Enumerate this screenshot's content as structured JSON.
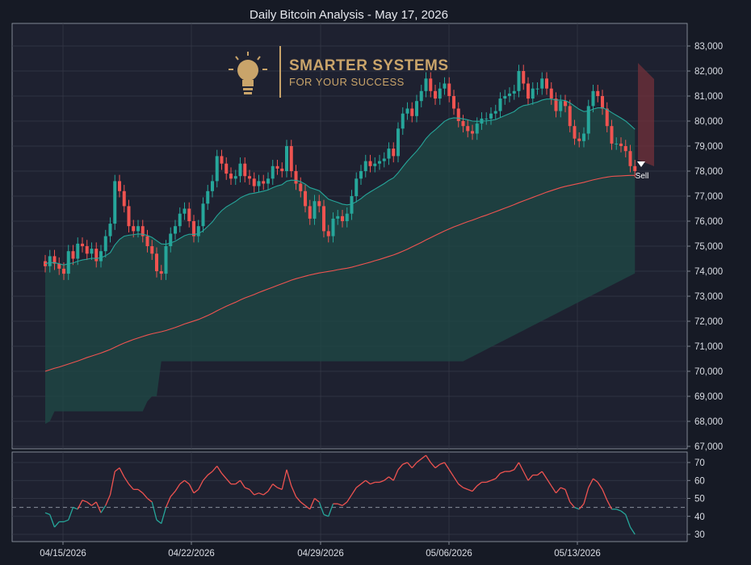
{
  "title": "Daily Bitcoin Analysis - May 17, 2026",
  "logo": {
    "line1": "SMARTER SYSTEMS",
    "line2": "FOR YOUR SUCCESS"
  },
  "colors": {
    "background": "#161a25",
    "panel": "#1e2130",
    "grid": "#363a48",
    "up": "#26a69a",
    "down": "#ef5350",
    "cloud": "#1f4a45",
    "ema_slow": "#ef5350",
    "ema_fast": "#26a69a",
    "logo": "#c9a46a"
  },
  "signal": {
    "label": "Sell"
  },
  "chart_data": [
    {
      "type": "candlestick",
      "title": "Daily Bitcoin Analysis - May 17, 2026",
      "x_tick_labels": [
        "04/15/2026",
        "04/22/2026",
        "04/29/2026",
        "05/06/2026",
        "05/13/2026"
      ],
      "y_ticks": [
        67000,
        68000,
        69000,
        70000,
        71000,
        72000,
        73000,
        74000,
        75000,
        76000,
        77000,
        78000,
        79000,
        80000,
        81000,
        82000,
        83000
      ],
      "ylim": [
        67000,
        83300
      ],
      "grid": true,
      "legend": "none",
      "close": [
        74200,
        74600,
        74300,
        74100,
        73900,
        74800,
        74500,
        75100,
        75000,
        74700,
        74900,
        74400,
        74800,
        75400,
        75900,
        77600,
        77200,
        76600,
        75800,
        75600,
        75800,
        75400,
        75000,
        74700,
        74000,
        73900,
        75000,
        75500,
        75800,
        76300,
        76500,
        76000,
        75400,
        75800,
        76700,
        77200,
        77600,
        78600,
        78300,
        77900,
        77700,
        77800,
        78300,
        77800,
        77700,
        77400,
        77600,
        77500,
        77700,
        78200,
        78100,
        78000,
        79000,
        78000,
        77500,
        77200,
        76600,
        76100,
        76800,
        76600,
        75600,
        75400,
        76100,
        76200,
        76000,
        76300,
        77000,
        77700,
        78000,
        78400,
        78200,
        78300,
        78400,
        78500,
        78900,
        78600,
        79700,
        80300,
        80500,
        80200,
        80800,
        81200,
        81700,
        81200,
        80900,
        81300,
        81500,
        81000,
        80500,
        80000,
        79800,
        79600,
        79500,
        79900,
        80100,
        80100,
        80300,
        80400,
        80900,
        81000,
        81100,
        81200,
        82000,
        81500,
        80900,
        81300,
        81300,
        81700,
        81300,
        80900,
        80400,
        80800,
        80600,
        79800,
        79300,
        79200,
        79500,
        80600,
        81200,
        81000,
        80500,
        79800,
        79100,
        79100,
        79000,
        78800,
        78200,
        78000
      ],
      "open": [
        74400,
        74200,
        74600,
        74300,
        74100,
        73900,
        74800,
        74500,
        75100,
        75000,
        74700,
        74900,
        74400,
        74800,
        75400,
        75900,
        77600,
        77200,
        76600,
        75800,
        75600,
        75800,
        75400,
        75000,
        74700,
        74000,
        73900,
        75000,
        75500,
        75800,
        76300,
        76500,
        76000,
        75400,
        75800,
        76700,
        77200,
        77600,
        78600,
        78300,
        77900,
        77700,
        77800,
        78300,
        77800,
        77700,
        77400,
        77600,
        77500,
        77700,
        78200,
        78100,
        78000,
        79000,
        78000,
        77500,
        77200,
        76600,
        76100,
        76800,
        76600,
        75600,
        75400,
        76100,
        76200,
        76000,
        76300,
        77000,
        77700,
        78000,
        78400,
        78200,
        78300,
        78400,
        78500,
        78900,
        78600,
        79700,
        80300,
        80500,
        80200,
        80800,
        81200,
        81700,
        81200,
        80900,
        81300,
        81500,
        81000,
        80500,
        80000,
        79800,
        79600,
        79500,
        79900,
        80100,
        80100,
        80300,
        80400,
        80900,
        81000,
        81100,
        81200,
        82000,
        81500,
        80900,
        81300,
        81300,
        81700,
        81300,
        80900,
        80400,
        80800,
        80600,
        79800,
        79300,
        79200,
        79500,
        80600,
        81200,
        81000,
        80500,
        79800,
        79100,
        79100,
        79000,
        78800,
        78200
      ],
      "ema_fast": [
        74300,
        74350,
        74340,
        74300,
        74250,
        74300,
        74330,
        74400,
        74450,
        74480,
        74520,
        74510,
        74540,
        74620,
        74740,
        75050,
        75270,
        75400,
        75440,
        75460,
        75490,
        75480,
        75430,
        75350,
        75220,
        75090,
        75080,
        75130,
        75200,
        75310,
        75420,
        75480,
        75470,
        75500,
        75620,
        75790,
        75970,
        76220,
        76420,
        76570,
        76680,
        76790,
        76930,
        77020,
        77090,
        77120,
        77160,
        77200,
        77250,
        77340,
        77410,
        77460,
        77600,
        77640,
        77630,
        77580,
        77480,
        77340,
        77280,
        77220,
        77050,
        76880,
        76810,
        76750,
        76680,
        76650,
        76680,
        76780,
        76900,
        77050,
        77170,
        77280,
        77390,
        77500,
        77630,
        77730,
        77930,
        78170,
        78400,
        78600,
        78800,
        79030,
        79300,
        79500,
        79650,
        79820,
        79990,
        80090,
        80130,
        80120,
        80090,
        80050,
        80000,
        79990,
        80000,
        80010,
        80030,
        80060,
        80140,
        80220,
        80300,
        80380,
        80530,
        80620,
        80650,
        80710,
        80760,
        80840,
        80880,
        80880,
        80840,
        80840,
        80820,
        80730,
        80600,
        80470,
        80380,
        80400,
        80480,
        80530,
        80530,
        80460,
        80340,
        80230,
        80120,
        80000,
        79840,
        79670
      ],
      "ema_slow": [
        70000,
        70060,
        70120,
        70170,
        70230,
        70290,
        70350,
        70410,
        70480,
        70550,
        70610,
        70670,
        70730,
        70800,
        70870,
        70960,
        71050,
        71130,
        71200,
        71270,
        71330,
        71390,
        71450,
        71500,
        71540,
        71580,
        71630,
        71690,
        71750,
        71820,
        71890,
        71950,
        72010,
        72070,
        72150,
        72230,
        72320,
        72420,
        72510,
        72600,
        72680,
        72760,
        72850,
        72930,
        73000,
        73070,
        73150,
        73220,
        73290,
        73360,
        73430,
        73500,
        73570,
        73640,
        73700,
        73750,
        73800,
        73850,
        73890,
        73930,
        73960,
        73990,
        74020,
        74060,
        74090,
        74120,
        74160,
        74210,
        74260,
        74310,
        74360,
        74420,
        74470,
        74530,
        74590,
        74650,
        74720,
        74800,
        74880,
        74970,
        75060,
        75150,
        75250,
        75340,
        75430,
        75520,
        75610,
        75690,
        75770,
        75840,
        75910,
        75980,
        76040,
        76110,
        76180,
        76240,
        76310,
        76380,
        76450,
        76520,
        76590,
        76660,
        76740,
        76810,
        76880,
        76950,
        77020,
        77090,
        77160,
        77220,
        77280,
        77340,
        77390,
        77430,
        77470,
        77510,
        77550,
        77600,
        77650,
        77690,
        77730,
        77760,
        77790,
        77800,
        77810,
        77820,
        77830,
        77830
      ],
      "cloud_low": [
        67900,
        68000,
        68400,
        68400,
        68400,
        68400,
        68400,
        68400,
        68400,
        68400,
        68400,
        68400,
        68400,
        68400,
        68400,
        68400,
        68400,
        68400,
        68400,
        68400,
        68400,
        68400,
        68800,
        69000,
        69000,
        70400,
        70400,
        70400,
        70400,
        70400,
        70400,
        70400,
        70400,
        70400,
        70400,
        70400,
        70400,
        70400,
        70400,
        70400,
        70400,
        70400,
        70400,
        70400,
        70400,
        70400,
        70400,
        70400,
        70400,
        70400,
        70400,
        70400,
        70400,
        70400,
        70400,
        70400,
        70400,
        70400,
        70400,
        70400,
        70400,
        70400,
        70400,
        70400,
        70400,
        70400,
        70400,
        70400,
        70400,
        70400,
        70400,
        70400,
        70400,
        70400,
        70400,
        70400,
        70400,
        70400,
        70400,
        70400,
        70400,
        70400,
        70400,
        70400,
        70400,
        70400,
        70400,
        70400,
        70400,
        70400,
        70400,
        70400,
        70400,
        70400,
        70400,
        70400,
        70400,
        70400,
        70400,
        70400,
        70400,
        70400,
        70400,
        70400,
        70400,
        70400,
        70400,
        70400,
        70400,
        70400,
        70400,
        70400,
        70400,
        70400,
        70400,
        70400,
        70400,
        70400,
        70400,
        70400,
        70400,
        70400,
        70400,
        70400,
        70400,
        70400,
        70400,
        70400
      ],
      "cloud_high": [
        74000,
        74000,
        74000,
        74000,
        74000,
        74000,
        74000,
        74000,
        74000,
        74000,
        74000,
        74000,
        74000,
        74000,
        74000,
        74000,
        74000,
        74000,
        74000,
        74000,
        74000,
        74000,
        74000,
        74000,
        74000,
        74000,
        74000,
        74000,
        74000,
        74000,
        74000,
        74000,
        74000,
        74000,
        74000,
        74000,
        74000,
        74000,
        74000,
        74000,
        74000,
        74000,
        74000,
        74000,
        74000,
        74000,
        74000,
        74000,
        74000,
        74000,
        74000,
        74000,
        74000,
        74000,
        74000,
        74000,
        74000,
        74000,
        74000,
        74000,
        74000,
        74000,
        74000,
        74000,
        74000,
        74000,
        74000,
        74000,
        74000,
        74000,
        74000,
        74000,
        74000,
        74000,
        74000,
        74000,
        74000,
        74000,
        74000,
        74000,
        74000,
        74000,
        74000,
        74000,
        74000,
        74000,
        74000,
        74000,
        74000,
        74000,
        74000,
        74000,
        74000,
        74000,
        74000,
        74000,
        74000,
        74000,
        74000,
        74000,
        74000,
        74000,
        74000,
        74000,
        74000,
        74000,
        74000,
        74000,
        74000,
        74000,
        74000,
        74000,
        74000,
        74000,
        74000,
        74000,
        74000,
        74000,
        74000,
        74000,
        74000,
        74000,
        74000,
        74000,
        74000,
        74000,
        74000,
        74000,
        74000,
        74000
      ]
    },
    {
      "type": "line",
      "y_ticks": [
        30,
        40,
        50,
        60,
        70
      ],
      "ylim": [
        27,
        74
      ],
      "threshold": 45,
      "grid": true,
      "values": [
        42,
        41,
        34,
        37,
        37,
        38,
        45,
        44,
        49,
        48,
        46,
        48,
        42,
        46,
        52,
        65,
        67,
        62,
        58,
        55,
        55,
        53,
        50,
        48,
        38,
        36,
        45,
        51,
        54,
        58,
        60,
        58,
        53,
        55,
        60,
        63,
        65,
        68,
        64,
        61,
        58,
        58,
        60,
        56,
        55,
        52,
        53,
        52,
        54,
        58,
        56,
        55,
        66,
        57,
        51,
        48,
        46,
        44,
        50,
        48,
        41,
        40,
        47,
        47,
        46,
        48,
        52,
        56,
        58,
        60,
        58,
        59,
        59,
        60,
        62,
        60,
        66,
        69,
        70,
        67,
        70,
        72,
        74,
        70,
        67,
        69,
        70,
        66,
        62,
        58,
        56,
        55,
        54,
        57,
        59,
        59,
        60,
        61,
        64,
        65,
        65,
        66,
        70,
        65,
        60,
        63,
        63,
        65,
        61,
        57,
        53,
        56,
        55,
        48,
        45,
        44,
        47,
        56,
        61,
        59,
        55,
        49,
        44,
        44,
        43,
        41,
        34,
        30
      ]
    }
  ]
}
